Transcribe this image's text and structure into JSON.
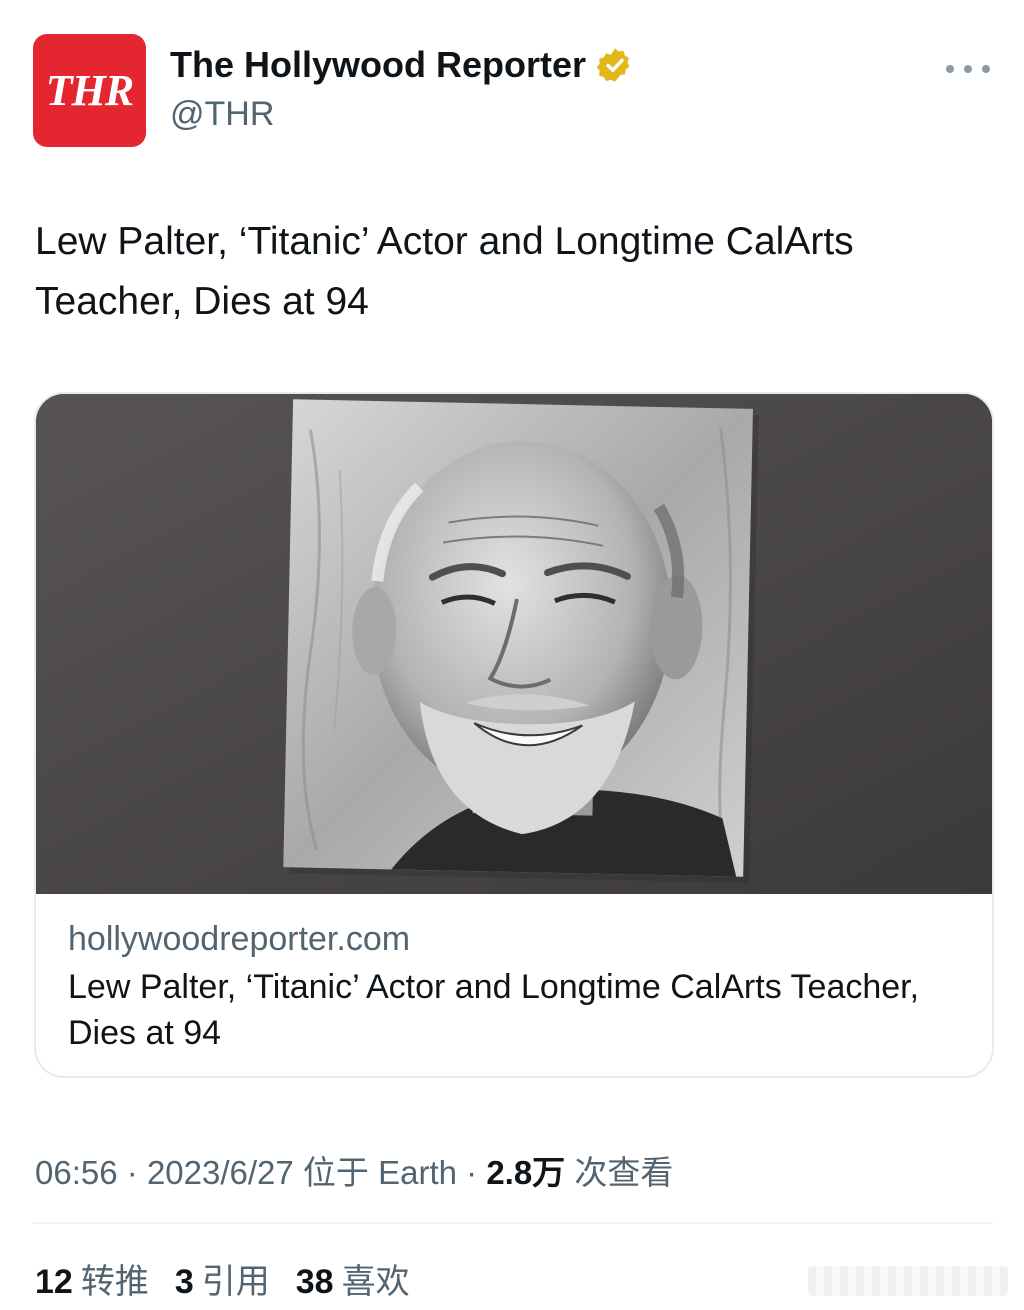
{
  "account": {
    "avatar_text": "THR",
    "display_name": "The Hollywood Reporter",
    "handle": "@THR",
    "verified_icon": "verified-badge-gold"
  },
  "tweet": {
    "text": "Lew Palter, ‘Titanic’ Actor and Longtime CalArts Teacher, Dies at 94"
  },
  "card": {
    "domain": "hollywoodreporter.com",
    "title": "Lew Palter, ‘Titanic’ Actor and Longtime CalArts Teacher, Dies at 94"
  },
  "meta": {
    "time": "06:56",
    "separator": "·",
    "date": "2023/6/27",
    "location": "位于 Earth",
    "views_count": "2.8万",
    "views_label": "次查看"
  },
  "stats": {
    "retweets_count": "12",
    "retweets_label": "转推",
    "quotes_count": "3",
    "quotes_label": "引用",
    "likes_count": "38",
    "likes_label": "喜欢"
  },
  "colors": {
    "avatar_bg": "#e3262f",
    "verified_gold": "#e2b719",
    "secondary_text": "#536471",
    "primary_text": "#0f1419"
  }
}
